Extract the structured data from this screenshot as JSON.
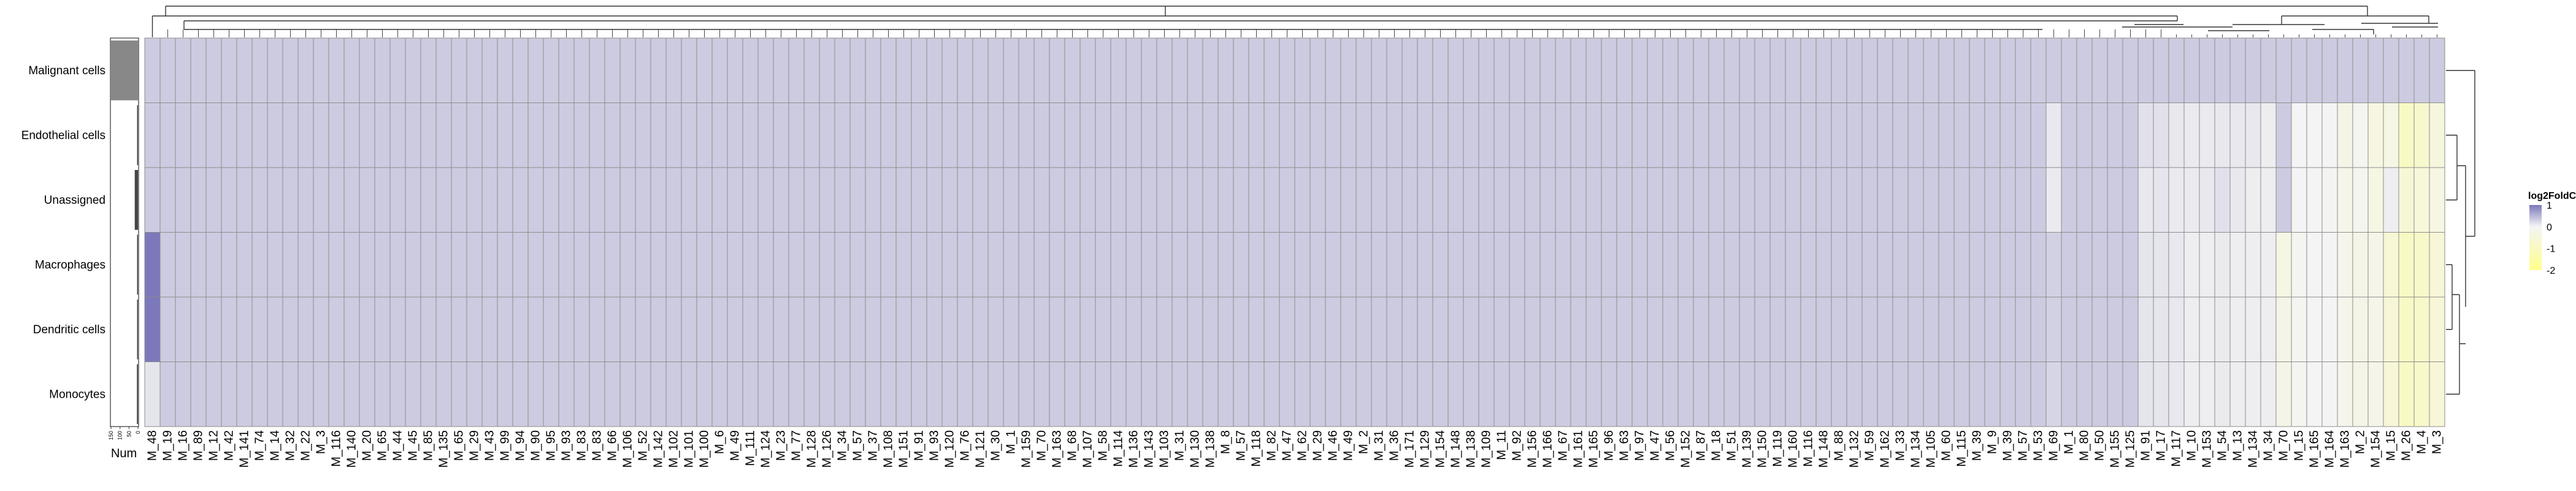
{
  "chart_data": {
    "type": "heatmap",
    "rows": [
      "Malignant cells",
      "Endothelial cells",
      "Unassigned",
      "Macrophages",
      "Dendritic cells",
      "Monocytes"
    ],
    "row_order_note": "",
    "columns": [
      "M_48",
      "M_19",
      "M_16",
      "M_89",
      "M_12",
      "M_42",
      "M_141",
      "M_74",
      "M_14",
      "M_32",
      "M_22",
      "M_3",
      "M_116",
      "M_140",
      "M_20",
      "M_65",
      "M_44",
      "M_45",
      "M_85",
      "M_135",
      "M_65",
      "M_29",
      "M_43",
      "M_99",
      "M_94",
      "M_90",
      "M_95",
      "M_93",
      "M_83",
      "M_83",
      "M_66",
      "M_106",
      "M_52",
      "M_142",
      "M_102",
      "M_101",
      "M_100",
      "M_6",
      "M_49",
      "M_111",
      "M_124",
      "M_23",
      "M_77",
      "M_128",
      "M_126",
      "M_34",
      "M_57",
      "M_37",
      "M_108",
      "M_151",
      "M_91",
      "M_93",
      "M_120",
      "M_76",
      "M_121",
      "M_30",
      "M_1",
      "M_159",
      "M_70",
      "M_163",
      "M_68",
      "M_107",
      "M_58",
      "M_114",
      "M_136",
      "M_143",
      "M_103",
      "M_31",
      "M_130",
      "M_138",
      "M_8",
      "M_57",
      "M_118",
      "M_82",
      "M_47",
      "M_62",
      "M_29",
      "M_46",
      "M_49",
      "M_2",
      "M_31",
      "M_36",
      "M_171",
      "M_129",
      "M_154",
      "M_148",
      "M_138",
      "M_109",
      "M_11",
      "M_92",
      "M_156",
      "M_166",
      "M_67",
      "M_161",
      "M_165",
      "M_96",
      "M_63",
      "M_97",
      "M_47",
      "M_56",
      "M_152",
      "M_87",
      "M_18",
      "M_51",
      "M_139",
      "M_150",
      "M_119",
      "M_160",
      "M_116",
      "M_148",
      "M_88",
      "M_132",
      "M_59",
      "M_162",
      "M_33",
      "M_134",
      "M_105",
      "M_60",
      "M_115",
      "M_39",
      "M_9",
      "M_39",
      "M_57",
      "M_53",
      "M_69",
      "M_1",
      "M_80",
      "M_50",
      "M_155",
      "M_125",
      "M_91",
      "M_17",
      "M_117",
      "M_10",
      "M_153",
      "M_54",
      "M_13",
      "M_134",
      "M_34",
      "M_70",
      "M_15",
      "M_165",
      "M_164",
      "M_163",
      "M_2",
      "M_154",
      "M_15",
      "M_26",
      "M_4",
      "M_3"
    ],
    "column_values_rows": "one array per row, one value per column (log2FoldChange)",
    "values": [
      [
        0.33,
        0.33,
        0.33,
        0.33,
        0.33,
        0.33,
        0.33,
        0.33,
        0.33,
        0.33,
        0.33,
        0.33,
        0.33,
        0.33,
        0.33,
        0.33,
        0.33,
        0.33,
        0.33,
        0.33,
        0.33,
        0.33,
        0.33,
        0.33,
        0.33,
        0.33,
        0.33,
        0.33,
        0.33,
        0.33,
        0.33,
        0.33,
        0.33,
        0.33,
        0.33,
        0.33,
        0.33,
        0.33,
        0.33,
        0.33,
        0.33,
        0.33,
        0.33,
        0.33,
        0.33,
        0.33,
        0.33,
        0.33,
        0.33,
        0.33,
        0.33,
        0.33,
        0.33,
        0.33,
        0.33,
        0.33,
        0.33,
        0.33,
        0.33,
        0.33,
        0.33,
        0.33,
        0.33,
        0.33,
        0.33,
        0.33,
        0.33,
        0.33,
        0.33,
        0.33,
        0.33,
        0.33,
        0.33,
        0.33,
        0.33,
        0.33,
        0.33,
        0.33,
        0.33,
        0.33,
        0.33,
        0.33,
        0.33,
        0.33,
        0.33,
        0.33,
        0.33,
        0.33,
        0.33,
        0.33,
        0.33,
        0.33,
        0.33,
        0.33,
        0.33,
        0.33,
        0.33,
        0.33,
        0.33,
        0.33,
        0.33,
        0.33,
        0.33,
        0.33,
        0.33,
        0.33,
        0.33,
        0.33,
        0.33,
        0.33,
        0.33,
        0.33,
        0.33,
        0.33,
        0.33,
        0.33,
        0.33,
        0.33,
        0.33,
        0.33,
        0.33,
        0.33,
        0.33,
        0.33,
        0.33,
        0.33,
        0.33,
        0.33,
        0.33,
        0.33,
        0.33,
        0.33,
        0.33,
        0.33,
        0.33,
        0.33,
        0.33,
        0.33,
        0.33,
        0.33,
        0.33,
        0.33,
        0.33,
        0.33,
        0.33,
        0.33,
        0.33,
        0.33,
        0.33,
        0.33
      ],
      [
        0.33,
        0.33,
        0.33,
        0.33,
        0.33,
        0.33,
        0.33,
        0.33,
        0.33,
        0.33,
        0.33,
        0.33,
        0.33,
        0.33,
        0.33,
        0.33,
        0.33,
        0.33,
        0.33,
        0.33,
        0.33,
        0.33,
        0.33,
        0.33,
        0.33,
        0.33,
        0.33,
        0.33,
        0.33,
        0.33,
        0.33,
        0.33,
        0.33,
        0.33,
        0.33,
        0.33,
        0.33,
        0.33,
        0.33,
        0.33,
        0.33,
        0.33,
        0.33,
        0.33,
        0.33,
        0.33,
        0.33,
        0.33,
        0.33,
        0.33,
        0.33,
        0.33,
        0.33,
        0.33,
        0.33,
        0.33,
        0.33,
        0.33,
        0.33,
        0.33,
        0.33,
        0.33,
        0.33,
        0.33,
        0.33,
        0.33,
        0.33,
        0.33,
        0.33,
        0.33,
        0.33,
        0.33,
        0.33,
        0.33,
        0.33,
        0.33,
        0.33,
        0.33,
        0.33,
        0.33,
        0.33,
        0.33,
        0.33,
        0.33,
        0.33,
        0.33,
        0.33,
        0.33,
        0.33,
        0.33,
        0.33,
        0.33,
        0.33,
        0.33,
        0.33,
        0.33,
        0.33,
        0.33,
        0.33,
        0.33,
        0.33,
        0.33,
        0.33,
        0.33,
        0.33,
        0.33,
        0.33,
        0.33,
        0.33,
        0.33,
        0.33,
        0.33,
        0.33,
        0.33,
        0.33,
        0.33,
        0.33,
        0.33,
        0.33,
        0.33,
        0.33,
        0.33,
        0.33,
        0.33,
        0.1,
        0.33,
        0.33,
        0.33,
        0.33,
        0.33,
        0.15,
        0.15,
        0.1,
        0.08,
        0.08,
        0.1,
        0.1,
        0.1,
        0.05,
        0.33,
        0,
        0,
        0,
        -0.25,
        -0.05,
        -0.35,
        -0.3,
        -0.9,
        -0.75,
        -0.45
      ],
      [
        0.33,
        0.33,
        0.33,
        0.33,
        0.33,
        0.33,
        0.33,
        0.33,
        0.33,
        0.33,
        0.33,
        0.33,
        0.33,
        0.33,
        0.33,
        0.33,
        0.33,
        0.33,
        0.33,
        0.33,
        0.33,
        0.33,
        0.33,
        0.33,
        0.33,
        0.33,
        0.33,
        0.33,
        0.33,
        0.33,
        0.33,
        0.33,
        0.33,
        0.33,
        0.33,
        0.33,
        0.33,
        0.33,
        0.33,
        0.33,
        0.33,
        0.33,
        0.33,
        0.33,
        0.33,
        0.33,
        0.33,
        0.33,
        0.33,
        0.33,
        0.33,
        0.33,
        0.33,
        0.33,
        0.33,
        0.33,
        0.33,
        0.33,
        0.33,
        0.33,
        0.33,
        0.33,
        0.33,
        0.33,
        0.33,
        0.33,
        0.33,
        0.33,
        0.33,
        0.33,
        0.33,
        0.33,
        0.33,
        0.33,
        0.33,
        0.33,
        0.33,
        0.33,
        0.33,
        0.33,
        0.33,
        0.33,
        0.33,
        0.33,
        0.33,
        0.33,
        0.33,
        0.33,
        0.33,
        0.33,
        0.33,
        0.33,
        0.33,
        0.33,
        0.33,
        0.33,
        0.33,
        0.33,
        0.33,
        0.33,
        0.33,
        0.33,
        0.33,
        0.33,
        0.33,
        0.33,
        0.33,
        0.33,
        0.33,
        0.33,
        0.33,
        0.33,
        0.33,
        0.33,
        0.33,
        0.33,
        0.33,
        0.33,
        0.33,
        0.33,
        0.33,
        0.33,
        0.33,
        0.33,
        0.08,
        0.33,
        0.33,
        0.33,
        0.33,
        0.33,
        0.1,
        0.12,
        0.08,
        0.08,
        0.1,
        0.15,
        0.1,
        0.05,
        0.05,
        0.33,
        0,
        0,
        -0.05,
        -0.2,
        -0.1,
        -0.3,
        0.05,
        -0.6,
        -0.5,
        -0.35
      ],
      [
        1.0,
        0.33,
        0.33,
        0.33,
        0.33,
        0.33,
        0.33,
        0.33,
        0.33,
        0.33,
        0.33,
        0.33,
        0.33,
        0.33,
        0.33,
        0.33,
        0.33,
        0.33,
        0.33,
        0.33,
        0.33,
        0.33,
        0.33,
        0.33,
        0.33,
        0.33,
        0.33,
        0.33,
        0.33,
        0.33,
        0.33,
        0.33,
        0.33,
        0.33,
        0.33,
        0.33,
        0.33,
        0.33,
        0.33,
        0.33,
        0.33,
        0.33,
        0.33,
        0.33,
        0.33,
        0.33,
        0.33,
        0.33,
        0.33,
        0.33,
        0.33,
        0.33,
        0.33,
        0.33,
        0.33,
        0.33,
        0.33,
        0.33,
        0.33,
        0.33,
        0.33,
        0.33,
        0.33,
        0.33,
        0.33,
        0.33,
        0.33,
        0.33,
        0.33,
        0.33,
        0.33,
        0.33,
        0.33,
        0.33,
        0.33,
        0.33,
        0.33,
        0.33,
        0.33,
        0.33,
        0.33,
        0.33,
        0.33,
        0.33,
        0.33,
        0.33,
        0.33,
        0.33,
        0.33,
        0.33,
        0.33,
        0.33,
        0.33,
        0.33,
        0.33,
        0.33,
        0.33,
        0.33,
        0.33,
        0.33,
        0.33,
        0.33,
        0.33,
        0.33,
        0.33,
        0.33,
        0.33,
        0.33,
        0.33,
        0.33,
        0.33,
        0.33,
        0.33,
        0.33,
        0.33,
        0.33,
        0.33,
        0.33,
        0.33,
        0.33,
        0.33,
        0.33,
        0.33,
        0.33,
        0.28,
        0.33,
        0.33,
        0.33,
        0.33,
        0.33,
        0.12,
        0.12,
        0.1,
        0.05,
        0.05,
        0.08,
        0.05,
        0.05,
        0.05,
        -0.3,
        -0.05,
        0,
        0,
        -0.15,
        -0.25,
        -0.2,
        -0.6,
        -0.9,
        -0.8,
        -0.55
      ],
      [
        1.0,
        0.33,
        0.33,
        0.33,
        0.33,
        0.33,
        0.33,
        0.33,
        0.33,
        0.33,
        0.33,
        0.33,
        0.33,
        0.33,
        0.33,
        0.33,
        0.33,
        0.33,
        0.33,
        0.33,
        0.33,
        0.33,
        0.33,
        0.33,
        0.33,
        0.33,
        0.33,
        0.33,
        0.33,
        0.33,
        0.33,
        0.33,
        0.33,
        0.33,
        0.33,
        0.33,
        0.33,
        0.33,
        0.33,
        0.33,
        0.33,
        0.33,
        0.33,
        0.33,
        0.33,
        0.33,
        0.33,
        0.33,
        0.33,
        0.33,
        0.33,
        0.33,
        0.33,
        0.33,
        0.33,
        0.33,
        0.33,
        0.33,
        0.33,
        0.33,
        0.33,
        0.33,
        0.33,
        0.33,
        0.33,
        0.33,
        0.33,
        0.33,
        0.33,
        0.33,
        0.33,
        0.33,
        0.33,
        0.33,
        0.33,
        0.33,
        0.33,
        0.33,
        0.33,
        0.33,
        0.33,
        0.33,
        0.33,
        0.33,
        0.33,
        0.33,
        0.33,
        0.33,
        0.33,
        0.33,
        0.33,
        0.33,
        0.33,
        0.33,
        0.33,
        0.33,
        0.33,
        0.33,
        0.33,
        0.33,
        0.33,
        0.33,
        0.33,
        0.33,
        0.33,
        0.33,
        0.33,
        0.33,
        0.33,
        0.33,
        0.33,
        0.33,
        0.33,
        0.33,
        0.33,
        0.33,
        0.33,
        0.33,
        0.33,
        0.33,
        0.33,
        0.33,
        0.33,
        0.33,
        0.28,
        0.33,
        0.33,
        0.33,
        0.33,
        0.33,
        0.12,
        0.12,
        0.1,
        0.05,
        0.05,
        0.08,
        0.05,
        0.05,
        0.05,
        -0.25,
        -0.05,
        0,
        0,
        -0.15,
        -0.25,
        -0.2,
        -0.55,
        -0.9,
        -0.8,
        -0.55
      ],
      [
        0.12,
        0.33,
        0.33,
        0.33,
        0.33,
        0.33,
        0.33,
        0.33,
        0.33,
        0.33,
        0.33,
        0.33,
        0.33,
        0.33,
        0.33,
        0.33,
        0.33,
        0.33,
        0.33,
        0.33,
        0.33,
        0.33,
        0.33,
        0.33,
        0.33,
        0.33,
        0.33,
        0.33,
        0.33,
        0.33,
        0.33,
        0.33,
        0.33,
        0.33,
        0.33,
        0.33,
        0.33,
        0.33,
        0.33,
        0.33,
        0.33,
        0.33,
        0.33,
        0.33,
        0.33,
        0.33,
        0.33,
        0.33,
        0.33,
        0.33,
        0.33,
        0.33,
        0.33,
        0.33,
        0.33,
        0.33,
        0.33,
        0.33,
        0.33,
        0.33,
        0.33,
        0.33,
        0.33,
        0.33,
        0.33,
        0.33,
        0.33,
        0.33,
        0.33,
        0.33,
        0.33,
        0.33,
        0.33,
        0.33,
        0.33,
        0.33,
        0.33,
        0.33,
        0.33,
        0.33,
        0.33,
        0.33,
        0.33,
        0.33,
        0.33,
        0.33,
        0.33,
        0.33,
        0.33,
        0.33,
        0.33,
        0.33,
        0.33,
        0.33,
        0.33,
        0.33,
        0.33,
        0.33,
        0.33,
        0.33,
        0.33,
        0.33,
        0.33,
        0.33,
        0.33,
        0.33,
        0.33,
        0.33,
        0.33,
        0.33,
        0.33,
        0.33,
        0.33,
        0.33,
        0.33,
        0.33,
        0.33,
        0.33,
        0.33,
        0.33,
        0.33,
        0.33,
        0.33,
        0.33,
        0.25,
        0.33,
        0.33,
        0.33,
        0.33,
        0.33,
        0.12,
        0.12,
        0.1,
        0.05,
        0.05,
        0.08,
        0.05,
        0.05,
        0.05,
        -0.25,
        -0.05,
        0,
        0,
        -0.15,
        -0.25,
        -0.2,
        -0.55,
        -0.9,
        -0.8,
        -0.55
      ]
    ],
    "row_annotation": {
      "title": "Num",
      "tick_labels": [
        "150",
        "100",
        "50",
        "0"
      ],
      "range": [
        0,
        150
      ],
      "values": [
        150,
        5,
        18,
        5,
        5,
        6
      ],
      "values_note": "bar lengths estimated from the row annotation"
    },
    "legend": {
      "title": "log2FoldChange",
      "labels": [
        "1",
        "0",
        "-1",
        "-2"
      ],
      "range": [
        -2,
        1
      ],
      "placement": "right"
    },
    "colors": {
      "high": "#7b78bb",
      "mid": "#f4f4f4",
      "low": "#ffff8c",
      "grid": "#8c8c8c",
      "annotation_bar": "#888888"
    }
  }
}
